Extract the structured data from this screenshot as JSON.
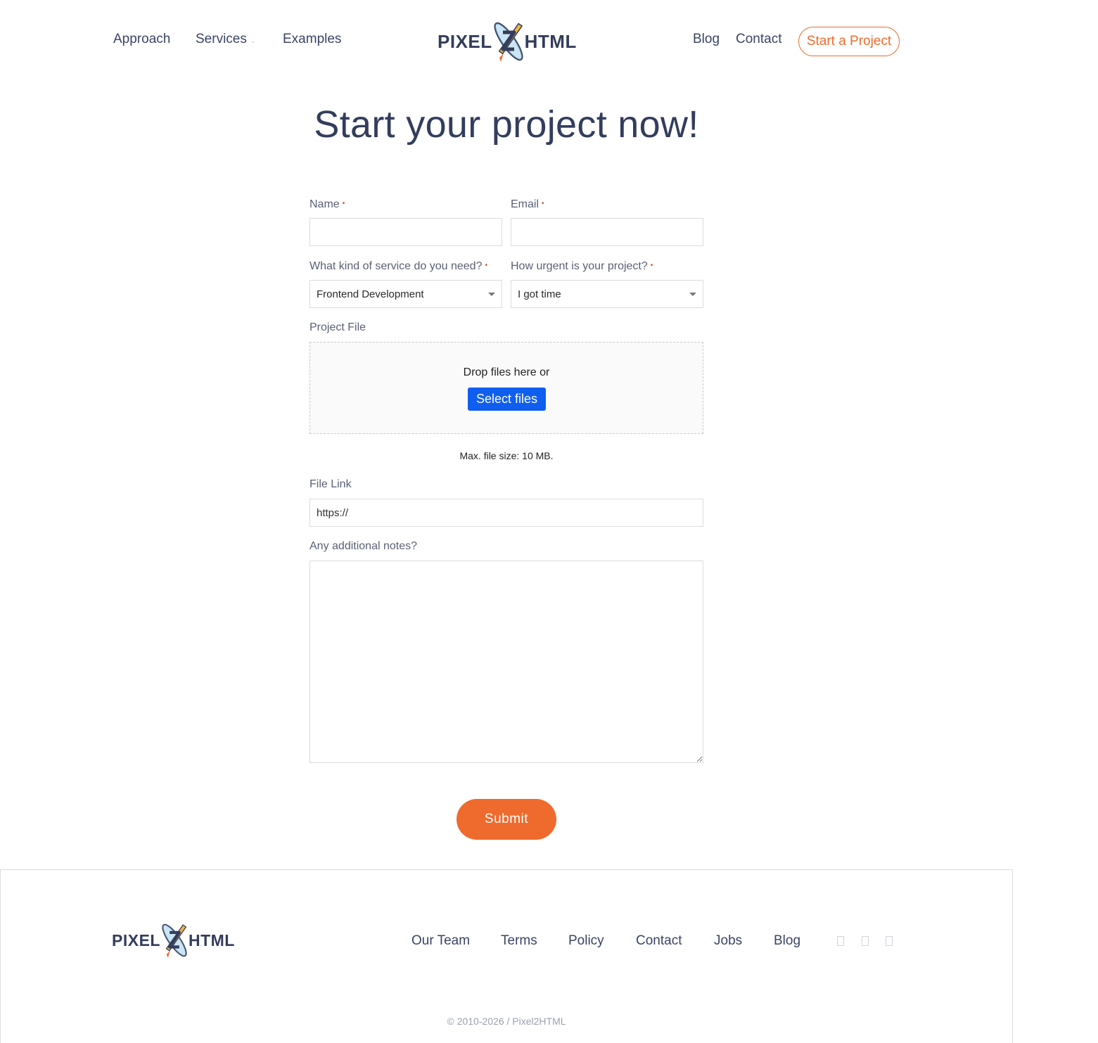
{
  "header": {
    "nav_left": [
      "Approach",
      "Services",
      "Examples"
    ],
    "services_chevron": "⌄",
    "logo_left": "PIXEL",
    "logo_right": "HTML",
    "nav_right": [
      "Blog",
      "Contact"
    ],
    "cta": "Start a Project"
  },
  "page": {
    "title": "Start your project now!"
  },
  "form": {
    "name_label": "Name",
    "email_label": "Email",
    "required_mark": "•",
    "service_label": "What kind of service do you need?",
    "service_value": "Frontend Development",
    "urgency_label": "How urgent is your project?",
    "urgency_value": "I got time",
    "project_file_label": "Project File",
    "drop_text": "Drop files here or",
    "select_files": "Select files",
    "file_hint": "Max. file size: 10 MB.",
    "file_link_label": "File Link",
    "file_link_value": "https://",
    "notes_label": "Any additional notes?",
    "submit": "Submit"
  },
  "footer": {
    "logo_left": "PIXEL",
    "logo_right": "HTML",
    "links": [
      "Our Team",
      "Terms",
      "Policy",
      "Contact",
      "Jobs",
      "Blog"
    ],
    "social_icons": [
      "facebook-icon",
      "twitter-icon",
      "linkedin-icon"
    ],
    "copyright": "© 2010-2026 / Pixel2HTML"
  },
  "colors": {
    "accent": "#ef6b2d",
    "navy": "#333d5c",
    "primary_button": "#0f5ef0"
  }
}
